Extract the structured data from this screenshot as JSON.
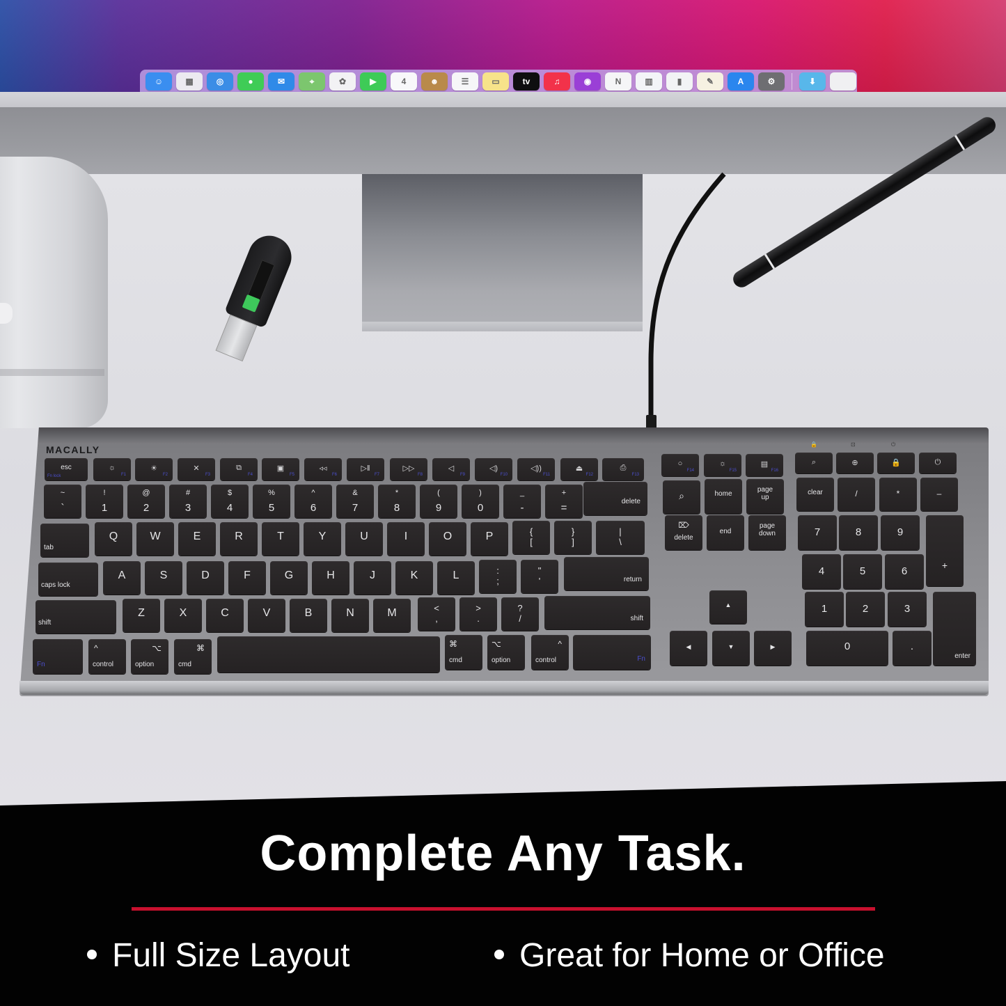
{
  "monitor": {
    "dock": {
      "apps": [
        {
          "name": "Finder",
          "icon": "finder-icon",
          "color": "#3a8ef0",
          "glyph": "☺"
        },
        {
          "name": "Launchpad",
          "icon": "launchpad-icon",
          "color": "#eceaf0",
          "glyph": "▦"
        },
        {
          "name": "Safari",
          "icon": "safari-icon",
          "color": "#3b8de6",
          "glyph": "◎"
        },
        {
          "name": "Messages",
          "icon": "messages-icon",
          "color": "#3fcc56",
          "glyph": "●"
        },
        {
          "name": "Mail",
          "icon": "mail-icon",
          "color": "#2f8ae8",
          "glyph": "✉"
        },
        {
          "name": "Maps",
          "icon": "maps-icon",
          "color": "#7cc66e",
          "glyph": "⌖"
        },
        {
          "name": "Photos",
          "icon": "photos-icon",
          "color": "#f2f2f4",
          "glyph": "✿"
        },
        {
          "name": "FaceTime",
          "icon": "facetime-icon",
          "color": "#3ecb57",
          "glyph": "▶"
        },
        {
          "name": "Calendar",
          "icon": "calendar-icon",
          "color": "#f8f8fa",
          "glyph": "4"
        },
        {
          "name": "Contacts",
          "icon": "contacts-icon",
          "color": "#b98a4a",
          "glyph": "☻"
        },
        {
          "name": "Reminders",
          "icon": "reminders-icon",
          "color": "#f6f6f8",
          "glyph": "☰"
        },
        {
          "name": "Notes",
          "icon": "notes-icon",
          "color": "#f7e38a",
          "glyph": "▭"
        },
        {
          "name": "TV",
          "icon": "apple-tv-icon",
          "color": "#0e0e10",
          "glyph": "tv"
        },
        {
          "name": "Music",
          "icon": "music-icon",
          "color": "#f2324a",
          "glyph": "♫"
        },
        {
          "name": "Podcasts",
          "icon": "podcasts-icon",
          "color": "#9a3fd6",
          "glyph": "◉"
        },
        {
          "name": "News",
          "icon": "news-icon",
          "color": "#f5f5f7",
          "glyph": "N"
        },
        {
          "name": "Keynote",
          "icon": "keynote-icon",
          "color": "#f3f4f8",
          "glyph": "▥"
        },
        {
          "name": "Numbers",
          "icon": "numbers-icon",
          "color": "#f2f3f5",
          "glyph": "▮"
        },
        {
          "name": "Pages",
          "icon": "pages-icon",
          "color": "#f6f1e2",
          "glyph": "✎"
        },
        {
          "name": "App Store",
          "icon": "app-store-icon",
          "color": "#2a86ee",
          "glyph": "A"
        },
        {
          "name": "System Preferences",
          "icon": "system-preferences-icon",
          "color": "#6e6e72",
          "glyph": "⚙"
        }
      ],
      "right": [
        {
          "name": "Downloads",
          "icon": "folder-icon",
          "color": "#58b7ea",
          "glyph": "⬇"
        },
        {
          "name": "Trash",
          "icon": "trash-icon",
          "color": "#f0f0f2",
          "glyph": ""
        }
      ]
    }
  },
  "keyboard": {
    "brand": "MACALLY",
    "fn_row": [
      {
        "icon": "esc",
        "f": "",
        "label": "esc",
        "sub": "Fn lock"
      },
      {
        "icon": "☼",
        "f": "F1"
      },
      {
        "icon": "☀",
        "f": "F2"
      },
      {
        "icon": "✕",
        "f": "F3"
      },
      {
        "icon": "⧉",
        "f": "F4"
      },
      {
        "icon": "▣",
        "f": "F5"
      },
      {
        "icon": "◃◃",
        "f": "F6"
      },
      {
        "icon": "▷‖",
        "f": "F7"
      },
      {
        "icon": "▷▷",
        "f": "F8"
      },
      {
        "icon": "◁",
        "f": "F9"
      },
      {
        "icon": "◁)",
        "f": "F10"
      },
      {
        "icon": "◁))",
        "f": "F11"
      },
      {
        "icon": "⏏",
        "f": "F12"
      },
      {
        "icon": "⎙",
        "f": "F13"
      }
    ],
    "fn_row_right": [
      {
        "icon": "○",
        "f": "F14"
      },
      {
        "icon": "☼",
        "f": "F15"
      },
      {
        "icon": "▤",
        "f": "F16"
      }
    ],
    "fn_row_numpad": [
      {
        "icon": "⌕"
      },
      {
        "icon": "⊕"
      },
      {
        "icon": "🔒"
      },
      {
        "icon": "⏻"
      }
    ],
    "leds": [
      "🔒",
      "⊡",
      "⏻"
    ],
    "number_row": [
      {
        "top": "~",
        "bot": "`"
      },
      {
        "top": "!",
        "bot": "1"
      },
      {
        "top": "@",
        "bot": "2"
      },
      {
        "top": "#",
        "bot": "3"
      },
      {
        "top": "$",
        "bot": "4"
      },
      {
        "top": "%",
        "bot": "5"
      },
      {
        "top": "^",
        "bot": "6"
      },
      {
        "top": "&",
        "bot": "7"
      },
      {
        "top": "*",
        "bot": "8"
      },
      {
        "top": "(",
        "bot": "9"
      },
      {
        "top": ")",
        "bot": "0"
      },
      {
        "top": "_",
        "bot": "-"
      },
      {
        "top": "+",
        "bot": "="
      }
    ],
    "delete_label": "delete",
    "tab_label": "tab",
    "qwerty": [
      "Q",
      "W",
      "E",
      "R",
      "T",
      "Y",
      "U",
      "I",
      "O",
      "P"
    ],
    "brackets": [
      {
        "top": "{",
        "bot": "["
      },
      {
        "top": "}",
        "bot": "]"
      },
      {
        "top": "|",
        "bot": "\\"
      }
    ],
    "caps_label": "caps lock",
    "asdf": [
      "A",
      "S",
      "D",
      "F",
      "G",
      "H",
      "J",
      "K",
      "L"
    ],
    "semis": [
      {
        "top": ":",
        "bot": ";"
      },
      {
        "top": "\"",
        "bot": "'"
      }
    ],
    "return_label": "return",
    "shift_label": "shift",
    "zxcv": [
      "Z",
      "X",
      "C",
      "V",
      "B",
      "N",
      "M"
    ],
    "puncts": [
      {
        "top": "<",
        "bot": ","
      },
      {
        "top": ">",
        "bot": "."
      },
      {
        "top": "?",
        "bot": "/"
      }
    ],
    "bottom_left": [
      {
        "label": "Fn"
      },
      {
        "symbol": "^",
        "label": "control"
      },
      {
        "symbol": "⌥",
        "label": "option"
      },
      {
        "symbol": "⌘",
        "label": "cmd"
      }
    ],
    "bottom_right": [
      {
        "symbol": "⌘",
        "label": "cmd"
      },
      {
        "symbol": "⌥",
        "label": "option"
      },
      {
        "symbol": "^",
        "label": "control"
      },
      {
        "label": "Fn"
      }
    ],
    "nav": {
      "search_icon": "⌕",
      "home": "home",
      "page_up": "page up",
      "delete_icon": "⌦",
      "delete": "delete",
      "end": "end",
      "page_down": "page down"
    },
    "arrows": {
      "up": "▲",
      "left": "◀",
      "down": "▼",
      "right": "▶"
    },
    "numpad": {
      "row1": [
        "clear",
        "/",
        "*",
        "–"
      ],
      "row2": [
        "7",
        "8",
        "9"
      ],
      "plus": "+",
      "row3": [
        "4",
        "5",
        "6"
      ],
      "row4": [
        "1",
        "2",
        "3"
      ],
      "zero": "0",
      "dot": ".",
      "enter": "enter"
    },
    "fn_color": "#4b4fd0"
  },
  "banner": {
    "headline": "Complete Any Task.",
    "divider_color": "#c8102e",
    "bullets": [
      "Full Size Layout",
      "Great for Home or Office"
    ]
  }
}
